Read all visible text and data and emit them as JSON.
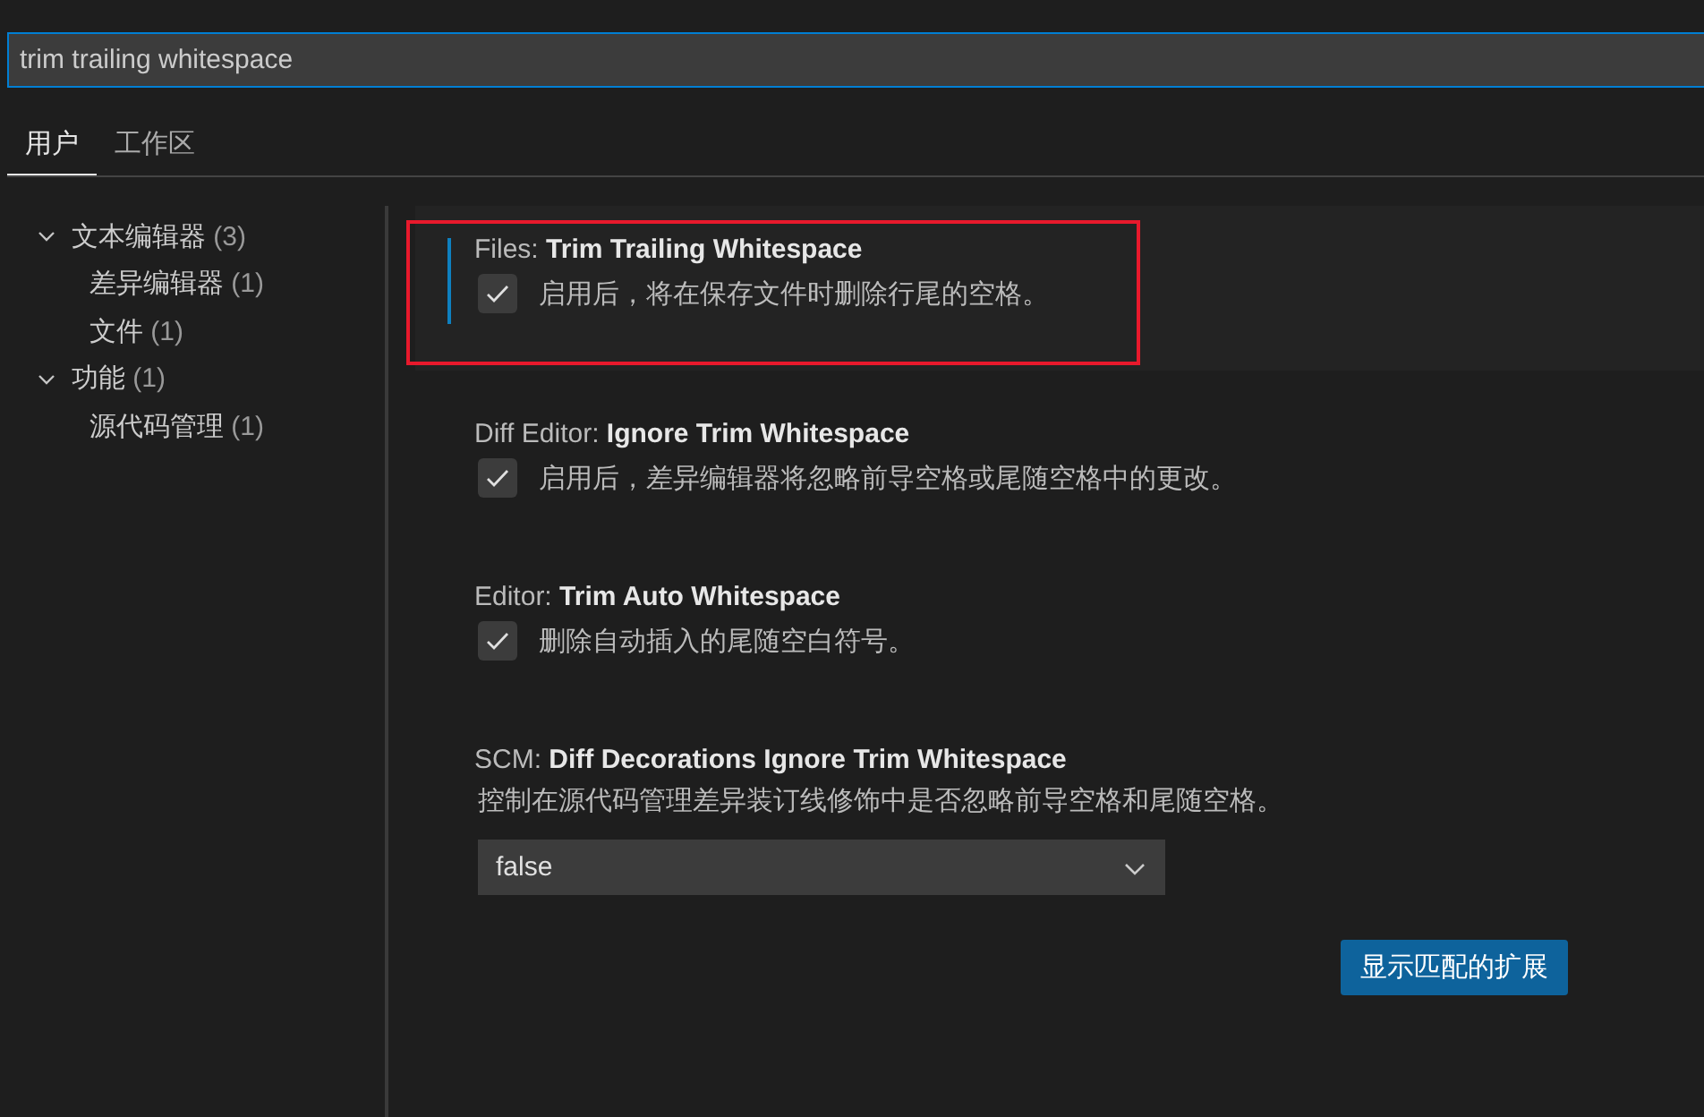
{
  "search": {
    "value": "trim trailing whitespace"
  },
  "tabs": [
    {
      "label": "用户",
      "selected": true
    },
    {
      "label": "工作区",
      "selected": false
    }
  ],
  "tree": [
    {
      "label": "文本编辑器",
      "count": "(3)",
      "expanded": true,
      "children": [
        {
          "label": "差异编辑器",
          "count": "(1)"
        },
        {
          "label": "文件",
          "count": "(1)"
        }
      ]
    },
    {
      "label": "功能",
      "count": "(1)",
      "expanded": true,
      "children": [
        {
          "label": "源代码管理",
          "count": "(1)"
        }
      ]
    }
  ],
  "settings": [
    {
      "kind": "checkbox",
      "category": "Files: ",
      "name": "Trim Trailing Whitespace",
      "description": "启用后，将在保存文件时删除行尾的空格。",
      "checked": true,
      "focused": true,
      "annotated": true
    },
    {
      "kind": "checkbox",
      "category": "Diff Editor: ",
      "name": "Ignore Trim Whitespace",
      "description": "启用后，差异编辑器将忽略前导空格或尾随空格中的更改。",
      "checked": true,
      "focused": false,
      "annotated": false
    },
    {
      "kind": "checkbox",
      "category": "Editor: ",
      "name": "Trim Auto Whitespace",
      "description": "删除自动插入的尾随空白符号。",
      "checked": true,
      "focused": false,
      "annotated": false
    },
    {
      "kind": "dropdown",
      "category": "SCM: ",
      "name": "Diff Decorations Ignore Trim Whitespace",
      "description": "控制在源代码管理差异装订线修饰中是否忽略前导空格和尾随空格。",
      "value": "false",
      "focused": false,
      "annotated": false
    }
  ],
  "button": {
    "label": "显示匹配的扩展"
  }
}
